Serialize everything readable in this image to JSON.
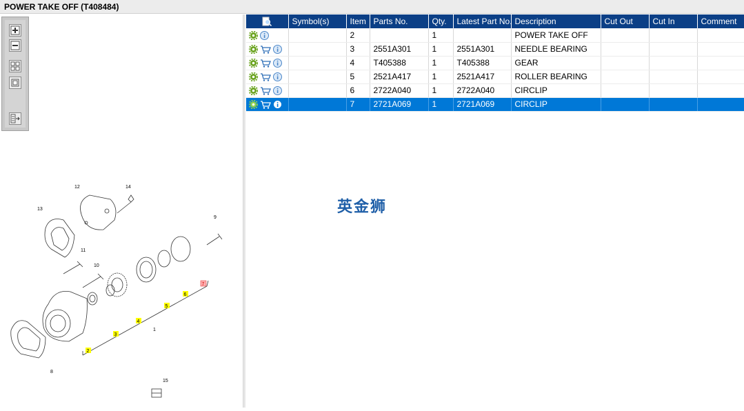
{
  "window": {
    "title": "POWER TAKE OFF (T408484)"
  },
  "toolbar": {
    "buttons": [
      {
        "name": "zoom-in-button",
        "icon": "zoom-in-icon"
      },
      {
        "name": "zoom-out-button",
        "icon": "zoom-out-icon"
      },
      {
        "name": "fit-all-button",
        "icon": "fit-icon"
      },
      {
        "name": "actual-size-button",
        "icon": "frame-icon"
      },
      {
        "name": "export-button",
        "icon": "export-icon"
      }
    ]
  },
  "diagram": {
    "callouts": [
      "1",
      "2",
      "3",
      "4",
      "5",
      "6",
      "7",
      "8",
      "9",
      "10",
      "11",
      "12",
      "13",
      "14",
      "15"
    ]
  },
  "parts_table": {
    "columns": [
      "",
      "Symbol(s)",
      "Item",
      "Parts No.",
      "Qty.",
      "Latest Part No.",
      "Description",
      "Cut Out",
      "Cut In",
      "Comment"
    ],
    "rows": [
      {
        "icons": [
          "gear-icon",
          "info-icon"
        ],
        "symbols": "",
        "item": "2",
        "part_no": "",
        "qty": "1",
        "latest": "",
        "description": "POWER TAKE OFF",
        "cut_out": "",
        "cut_in": "",
        "comment": "",
        "selected": false
      },
      {
        "icons": [
          "gear-icon",
          "cart-icon",
          "info-icon"
        ],
        "symbols": "",
        "item": "3",
        "part_no": "2551A301",
        "qty": "1",
        "latest": "2551A301",
        "description": "NEEDLE BEARING",
        "cut_out": "",
        "cut_in": "",
        "comment": "",
        "selected": false
      },
      {
        "icons": [
          "gear-icon",
          "cart-icon",
          "info-icon"
        ],
        "symbols": "",
        "item": "4",
        "part_no": "T405388",
        "qty": "1",
        "latest": "T405388",
        "description": "GEAR",
        "cut_out": "",
        "cut_in": "",
        "comment": "",
        "selected": false
      },
      {
        "icons": [
          "gear-icon",
          "cart-icon",
          "info-icon"
        ],
        "symbols": "",
        "item": "5",
        "part_no": "2521A417",
        "qty": "1",
        "latest": "2521A417",
        "description": "ROLLER BEARING",
        "cut_out": "",
        "cut_in": "",
        "comment": "",
        "selected": false
      },
      {
        "icons": [
          "gear-icon",
          "cart-icon",
          "info-icon"
        ],
        "symbols": "",
        "item": "6",
        "part_no": "2722A040",
        "qty": "1",
        "latest": "2722A040",
        "description": "CIRCLIP",
        "cut_out": "",
        "cut_in": "",
        "comment": "",
        "selected": false
      },
      {
        "icons": [
          "gear-icon",
          "cart-icon",
          "info-icon"
        ],
        "symbols": "",
        "item": "7",
        "part_no": "2721A069",
        "qty": "1",
        "latest": "2721A069",
        "description": "CIRCLIP",
        "cut_out": "",
        "cut_in": "",
        "comment": "",
        "selected": true
      }
    ]
  },
  "watermark": "英金狮",
  "colors": {
    "header_bg": "#0b3f86",
    "selected_row": "#0078d7",
    "gear_green": "#6aa31f",
    "info_blue": "#4a86c8"
  }
}
